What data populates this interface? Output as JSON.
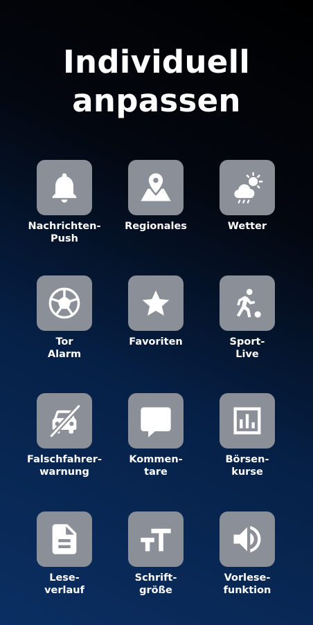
{
  "heading": {
    "line1": "Individuell",
    "line2": "anpassen"
  },
  "tiles": [
    {
      "icon": "bell-icon",
      "lines": [
        "Nachrichten-",
        "Push"
      ]
    },
    {
      "icon": "map-pin-icon",
      "lines": [
        "Regionales",
        ""
      ]
    },
    {
      "icon": "weather-icon",
      "lines": [
        "Wetter",
        ""
      ]
    },
    {
      "icon": "soccer-ball-icon",
      "lines": [
        "Tor",
        "Alarm"
      ]
    },
    {
      "icon": "star-icon",
      "lines": [
        "Favoriten",
        ""
      ]
    },
    {
      "icon": "soccer-player-icon",
      "lines": [
        "Sport-",
        "Live"
      ]
    },
    {
      "icon": "car-crossed-icon",
      "lines": [
        "Falschfahrer-",
        "warnung"
      ]
    },
    {
      "icon": "comment-icon",
      "lines": [
        "Kommen-",
        "tare"
      ]
    },
    {
      "icon": "bar-chart-icon",
      "lines": [
        "Börsen-",
        "kurse"
      ]
    },
    {
      "icon": "document-icon",
      "lines": [
        "Lese-",
        "verlauf"
      ]
    },
    {
      "icon": "text-size-icon",
      "lines": [
        "Schrift-",
        "größe"
      ]
    },
    {
      "icon": "speaker-icon",
      "lines": [
        "Vorlese-",
        "funktion"
      ]
    }
  ],
  "colors": {
    "tile_background": "#8a8f98",
    "icon": "#ffffff",
    "text": "#ffffff"
  }
}
